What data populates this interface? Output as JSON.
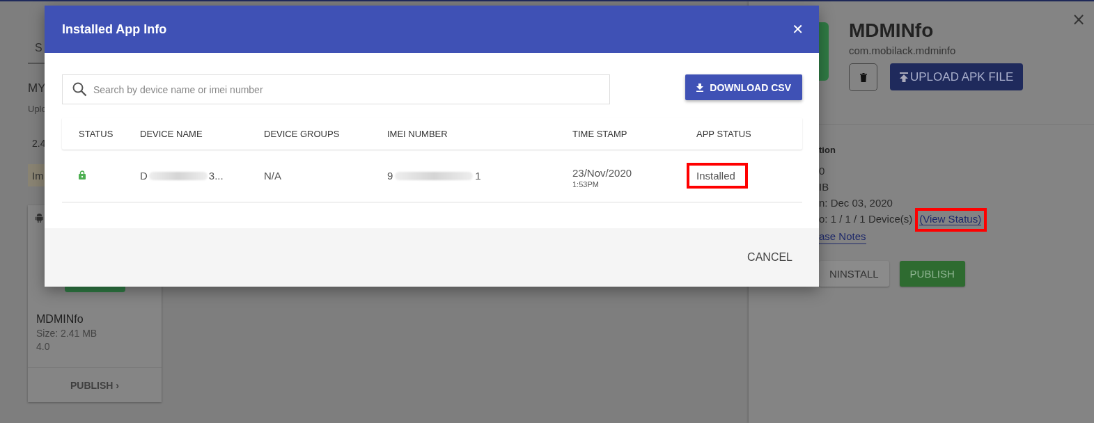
{
  "background": {
    "tab_fragment": "S",
    "section_title": "MY",
    "section_subtitle": "Uplo",
    "size_fragment": "2.4",
    "notice_fragment": "Im",
    "app_card": {
      "name": "MDMINfo",
      "size": "Size: 2.41 MB",
      "version": "4.0",
      "action": "PUBLISH ›"
    },
    "details_panel": {
      "close": "×",
      "app_name": "MDMINfo",
      "package": "com.mobilack.mdminfo",
      "upload_button": "UPLOAD APK FILE",
      "section_heading": "tion",
      "lines": [
        "0",
        "IB",
        "n: Dec 03, 2020"
      ],
      "installed_on": "o: 1 / 1 / 1 Device(s)",
      "view_status_link": "(View Status)",
      "release_notes_link": "ase Notes",
      "buttons": [
        {
          "label": "NINSTALL",
          "kind": "plain"
        },
        {
          "label": "PUBLISH",
          "kind": "primary"
        }
      ]
    }
  },
  "dialog": {
    "title": "Installed App Info",
    "close": "✕",
    "search": {
      "placeholder": "Search by device name or imei number"
    },
    "download_button": "DOWNLOAD CSV",
    "table": {
      "columns": [
        "STATUS",
        "DEVICE NAME",
        "DEVICE GROUPS",
        "IMEI NUMBER",
        "TIME STAMP",
        "APP STATUS"
      ],
      "rows": [
        {
          "locked": true,
          "device_name_start": "D",
          "device_name_end": "3...",
          "device_groups": "N/A",
          "imei_start": "9",
          "imei_end": "1",
          "date": "23/Nov/2020",
          "time": "1:53PM",
          "app_status": "Installed"
        }
      ]
    },
    "cancel_button": "CANCEL"
  }
}
